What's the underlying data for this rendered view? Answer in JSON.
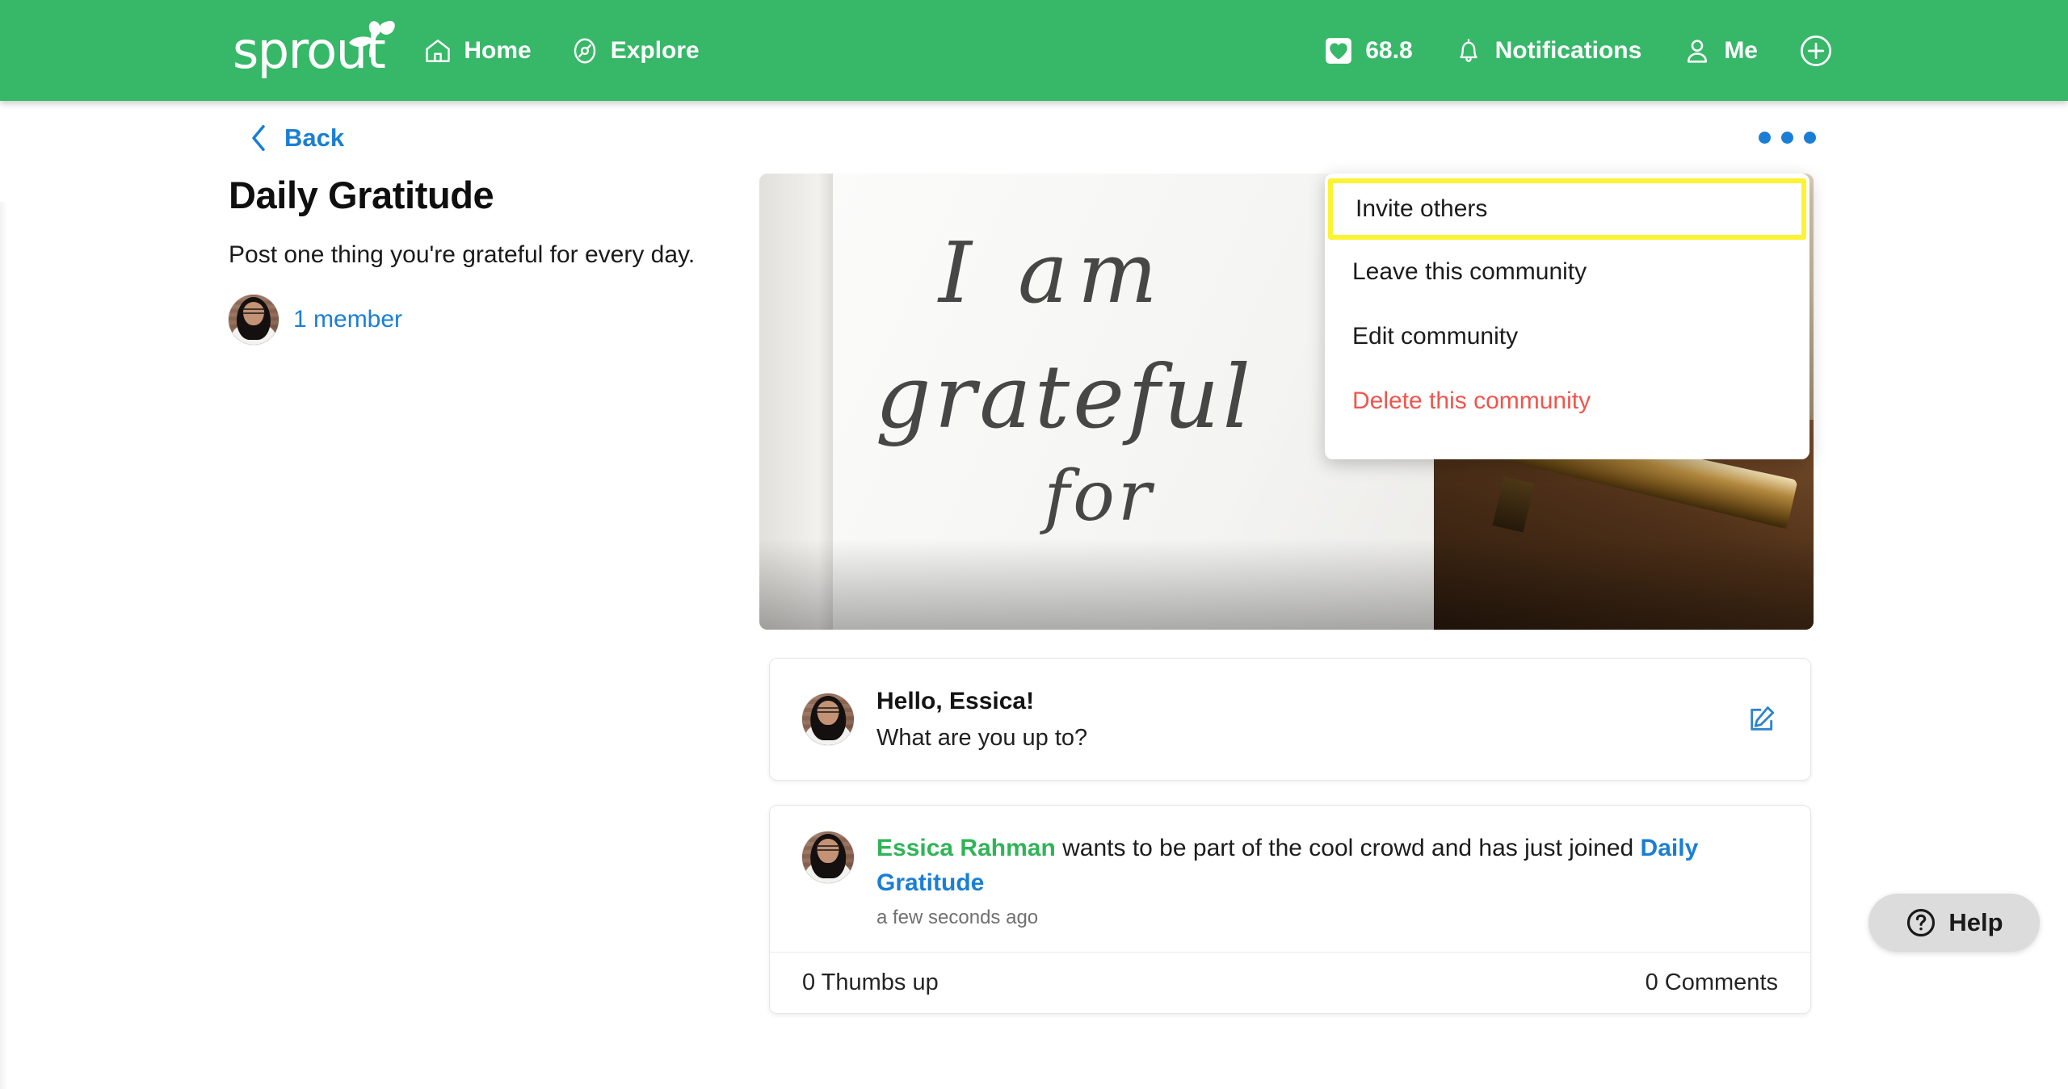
{
  "header": {
    "logo_text": "sprout",
    "logo_icon": "sprout-leaf-icon",
    "nav": [
      {
        "label": "Home",
        "icon": "home-icon"
      },
      {
        "label": "Explore",
        "icon": "compass-icon"
      }
    ],
    "karma": {
      "icon": "heart-badge-icon",
      "value": "68.8"
    },
    "notifications": {
      "icon": "bell-icon",
      "label": "Notifications"
    },
    "me": {
      "icon": "person-icon",
      "label": "Me"
    },
    "add": {
      "icon": "plus-circle-icon"
    },
    "background_color": "#36b868"
  },
  "toolbar": {
    "back_label": "Back",
    "back_icon": "chevron-left-icon",
    "kebab_icon": "more-options-icon"
  },
  "community": {
    "title": "Daily Gratitude",
    "description": "Post one thing you're grateful for every day.",
    "member_count_label": "1 member",
    "avatar_name": "member-avatar",
    "hero_image": {
      "alt": "Handwritten journal page reading 'I am grateful for' with a gold pen",
      "handwriting_line_1": "I am",
      "handwriting_line_2": "grateful",
      "handwriting_line_3": "for"
    }
  },
  "menu": {
    "items": [
      {
        "label": "Invite others",
        "style": "highlighted"
      },
      {
        "label": "Leave this community",
        "style": "normal"
      },
      {
        "label": "Edit community",
        "style": "normal"
      },
      {
        "label": "Delete this community",
        "style": "danger"
      }
    ],
    "highlight_color": "#fbf333",
    "danger_color": "#f0554c"
  },
  "compose": {
    "greeting": "Hello, Essica!",
    "prompt": "What are you up to?",
    "edit_icon": "edit-pencil-icon"
  },
  "activity": {
    "author": "Essica Rahman",
    "middle_text": " wants to be part of the cool crowd and has just joined ",
    "community_link": "Daily Gratitude",
    "timestamp": "a few seconds ago",
    "thumbs_up": "0 Thumbs up",
    "comments": "0 Comments"
  },
  "help_widget": {
    "label": "Help",
    "icon": "question-circle-icon"
  },
  "colors": {
    "brand_green": "#36b868",
    "link_blue": "#1a7fd4",
    "name_green": "#2fb457",
    "danger_red": "#f0554c",
    "highlight_yellow": "#fbf333"
  }
}
